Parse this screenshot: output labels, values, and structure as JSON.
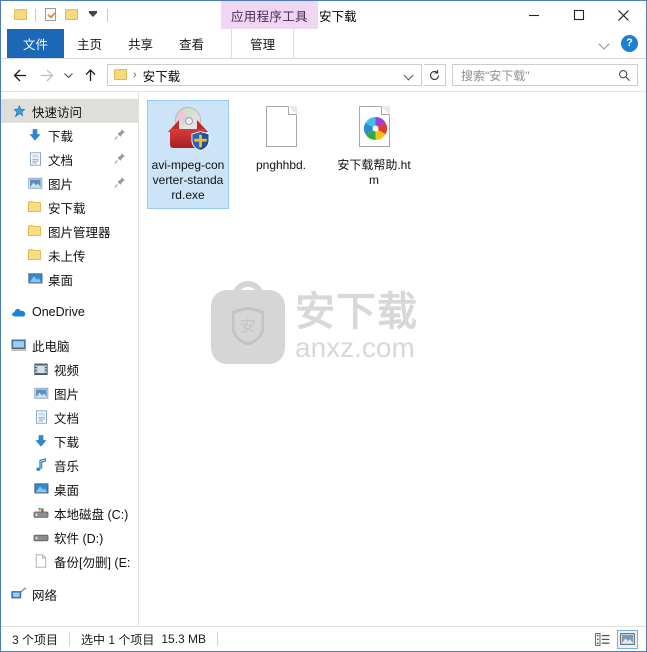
{
  "window": {
    "title": "安下载",
    "contextual_tab": "应用程序工具",
    "minimize_label": "最小化",
    "maximize_label": "最大化",
    "close_label": "关闭"
  },
  "quick_access_toolbar": {
    "items": [
      {
        "name": "folder-icon",
        "label": "属性"
      },
      {
        "name": "new-folder-icon",
        "label": "新建文件夹"
      },
      {
        "name": "customize-caret",
        "label": "自定义快速访问工具栏"
      }
    ]
  },
  "ribbon": {
    "tabs": [
      {
        "label": "文件",
        "selected": true
      },
      {
        "label": "主页",
        "selected": false
      },
      {
        "label": "共享",
        "selected": false
      },
      {
        "label": "查看",
        "selected": false
      }
    ],
    "contextual_tab": {
      "label": "管理",
      "selected": false
    },
    "collapse_label": "折叠功能区",
    "help_label": "?"
  },
  "navbar": {
    "back_label": "后退",
    "forward_label": "前进",
    "recent_label": "最近浏览的位置",
    "up_label": "上移到",
    "breadcrumb": {
      "separator": "›",
      "path": [
        "安下载"
      ]
    },
    "dropdown_label": "以前的位置",
    "refresh_label": "刷新",
    "search": {
      "placeholder": "搜索\"安下载\"",
      "value": "",
      "icon": "search-icon"
    }
  },
  "sidebar": {
    "groups": [
      {
        "name": "quick-access",
        "header": {
          "label": "快速访问",
          "icon": "star-pin-icon",
          "selected": true
        },
        "items": [
          {
            "label": "下载",
            "icon": "download-arrow-icon",
            "pinned": true
          },
          {
            "label": "文档",
            "icon": "documents-icon",
            "pinned": true
          },
          {
            "label": "图片",
            "icon": "pictures-icon",
            "pinned": true
          },
          {
            "label": "安下载",
            "icon": "folder-icon",
            "pinned": false
          },
          {
            "label": "图片管理器",
            "icon": "folder-icon",
            "pinned": false
          },
          {
            "label": "未上传",
            "icon": "folder-icon",
            "pinned": false
          },
          {
            "label": "桌面",
            "icon": "desktop-icon",
            "pinned": false
          }
        ]
      },
      {
        "name": "onedrive",
        "header": {
          "label": "OneDrive",
          "icon": "onedrive-cloud-icon",
          "selected": false
        },
        "items": []
      },
      {
        "name": "this-pc",
        "header": {
          "label": "此电脑",
          "icon": "computer-icon",
          "selected": false
        },
        "items": [
          {
            "label": "视频",
            "icon": "videos-icon",
            "pinned": false
          },
          {
            "label": "图片",
            "icon": "pictures-icon",
            "pinned": false
          },
          {
            "label": "文档",
            "icon": "documents-icon",
            "pinned": false
          },
          {
            "label": "下载",
            "icon": "download-arrow-icon",
            "pinned": false
          },
          {
            "label": "音乐",
            "icon": "music-note-icon",
            "pinned": false
          },
          {
            "label": "桌面",
            "icon": "desktop-icon",
            "pinned": false
          },
          {
            "label": "本地磁盘 (C:)",
            "icon": "system-drive-icon",
            "pinned": false
          },
          {
            "label": "软件 (D:)",
            "icon": "drive-icon",
            "pinned": false
          },
          {
            "label": "备份[勿删] (E:",
            "icon": "drive-blank-icon",
            "pinned": false
          }
        ]
      },
      {
        "name": "network",
        "header": {
          "label": "网络",
          "icon": "network-icon",
          "selected": false
        },
        "items": []
      }
    ]
  },
  "content": {
    "files": [
      {
        "name": "avi-mpeg-converter-standard.exe",
        "icon": "installer-package-icon",
        "selected": true
      },
      {
        "name": "pnghhbd.",
        "icon": "blank-document-icon",
        "selected": false
      },
      {
        "name": "安下载帮助.htm",
        "icon": "browser-document-icon",
        "selected": false
      }
    ],
    "watermark": {
      "logo_char": "安",
      "text_cn": "安下载",
      "text_en": "anxz.com"
    }
  },
  "statusbar": {
    "item_count": "3 个项目",
    "selection": "选中 1 个项目",
    "selection_size": "15.3 MB",
    "views": [
      {
        "name": "details-view-button",
        "label": "详细信息",
        "active": false
      },
      {
        "name": "large-icons-view-button",
        "label": "大图标",
        "active": true
      }
    ]
  },
  "colors": {
    "accent": "#1b69b6",
    "window_border": "#4a7ebb",
    "contextual_tab_bg": "#efd7f4",
    "selection_bg": "#cce4f7",
    "selection_border": "#99c9ef",
    "sidebar_selected_bg": "#dededa",
    "folder_yellow": "#f8dc86",
    "watermark_gray": "#d8d8d8"
  }
}
